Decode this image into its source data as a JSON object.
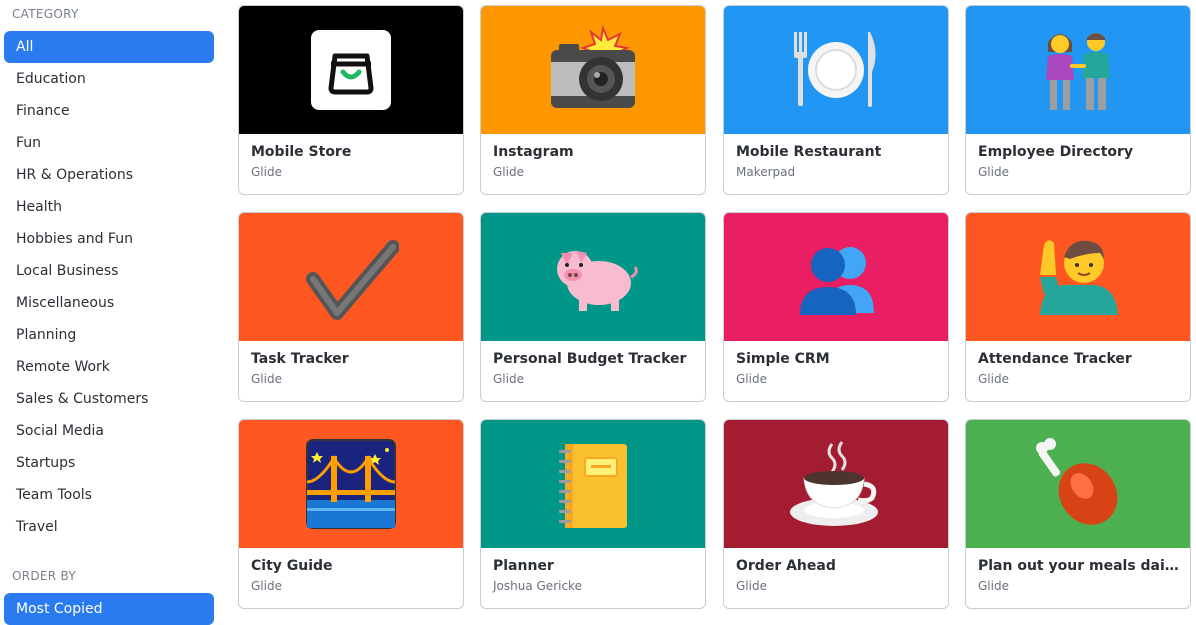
{
  "sidebar": {
    "category_label": "CATEGORY",
    "categories": [
      "All",
      "Education",
      "Finance",
      "Fun",
      "HR & Operations",
      "Health",
      "Hobbies and Fun",
      "Local Business",
      "Miscellaneous",
      "Planning",
      "Remote Work",
      "Sales & Customers",
      "Social Media",
      "Startups",
      "Team Tools",
      "Travel"
    ],
    "selected_category": "All",
    "order_label": "ORDER BY",
    "order_selected": "Most Copied"
  },
  "cards": [
    {
      "title": "Mobile Store",
      "author": "Glide",
      "bg": "#000000",
      "icon": "shopping-bag-icon"
    },
    {
      "title": "Instagram",
      "author": "Glide",
      "bg": "#ff9800",
      "icon": "camera-with-flash-icon"
    },
    {
      "title": "Mobile Restaurant",
      "author": "Makerpad",
      "bg": "#2196f3",
      "icon": "fork-knife-plate-icon"
    },
    {
      "title": "Employee Directory",
      "author": "Glide",
      "bg": "#2196f3",
      "icon": "people-holding-hands-icon"
    },
    {
      "title": "Task Tracker",
      "author": "Glide",
      "bg": "#ff5722",
      "icon": "check-mark-icon"
    },
    {
      "title": "Personal Budget Tracker",
      "author": "Glide",
      "bg": "#009688",
      "icon": "pig-icon"
    },
    {
      "title": "Simple CRM",
      "author": "Glide",
      "bg": "#e91e63",
      "icon": "busts-in-silhouette-icon"
    },
    {
      "title": "Attendance Tracker",
      "author": "Glide",
      "bg": "#ff5722",
      "icon": "person-raising-hand-icon"
    },
    {
      "title": "City Guide",
      "author": "Glide",
      "bg": "#ff5722",
      "icon": "bridge-at-night-icon"
    },
    {
      "title": "Planner",
      "author": "Joshua Gericke",
      "bg": "#009688",
      "icon": "notebook-icon"
    },
    {
      "title": "Order Ahead",
      "author": "Glide",
      "bg": "#a31c32",
      "icon": "hot-beverage-icon"
    },
    {
      "title": "Plan out your meals daily an...",
      "author": "Glide",
      "bg": "#4caf50",
      "icon": "poultry-leg-icon"
    }
  ]
}
